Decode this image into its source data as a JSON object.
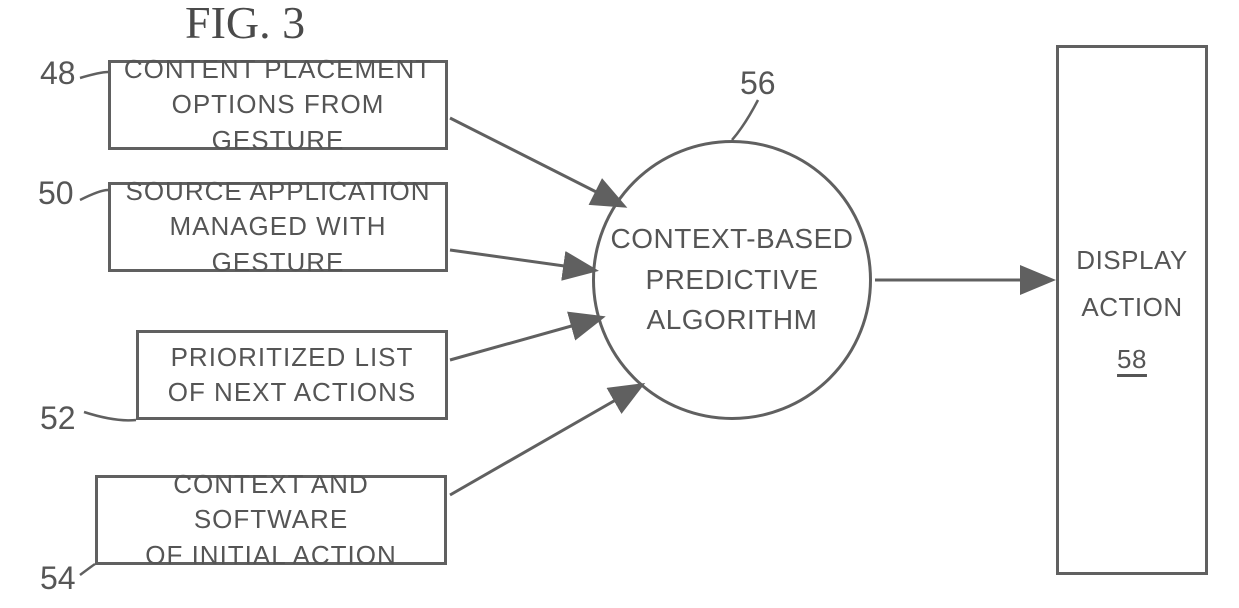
{
  "title": "FIG. 3",
  "refs": {
    "r48": "48",
    "r50": "50",
    "r52": "52",
    "r54": "54",
    "r56": "56",
    "r58": "58"
  },
  "inputs": {
    "b48_l1": "CONTENT PLACEMENT",
    "b48_l2": "OPTIONS FROM GESTURE",
    "b50_l1": "SOURCE APPLICATION",
    "b50_l2": "MANAGED WITH GESTURE",
    "b52_l1": "PRIORITIZED LIST",
    "b52_l2": "OF NEXT ACTIONS",
    "b54_l1": "CONTEXT AND SOFTWARE",
    "b54_l2": "OF INITIAL ACTION"
  },
  "algorithm": {
    "l1": "CONTEXT-BASED",
    "l2": "PREDICTIVE",
    "l3": "ALGORITHM"
  },
  "output": {
    "l1": "DISPLAY",
    "l2": "ACTION",
    "l3": "58"
  }
}
